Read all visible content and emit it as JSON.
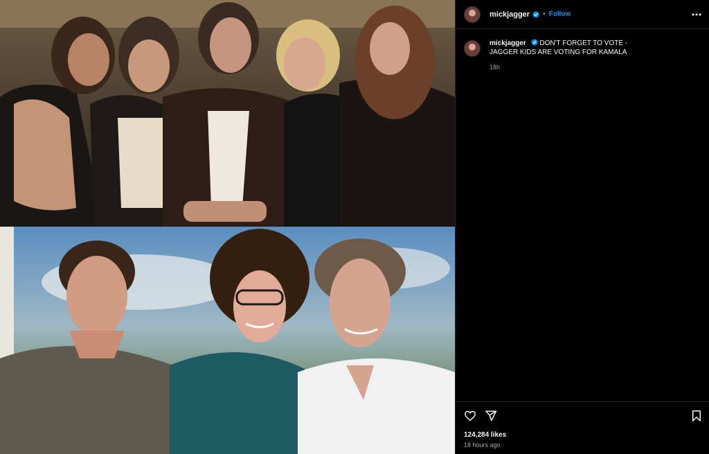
{
  "post": {
    "username": "mickjagger",
    "follow_label": "Follow",
    "separator": "•",
    "caption": "DON'T FORGET TO VOTE - JAGGER KIDS ARE VOTING FOR KAMALA",
    "caption_time": "18h",
    "likes": "124,284 likes",
    "time_ago": "18 hours ago"
  },
  "icons": {
    "verified": "verified-badge-icon",
    "more": "more-options-icon",
    "like": "heart-icon",
    "share": "share-icon",
    "save": "bookmark-icon"
  },
  "colors": {
    "background": "#000000",
    "accent": "#0095f6",
    "muted": "#a8a8a8",
    "divider": "#262626"
  }
}
